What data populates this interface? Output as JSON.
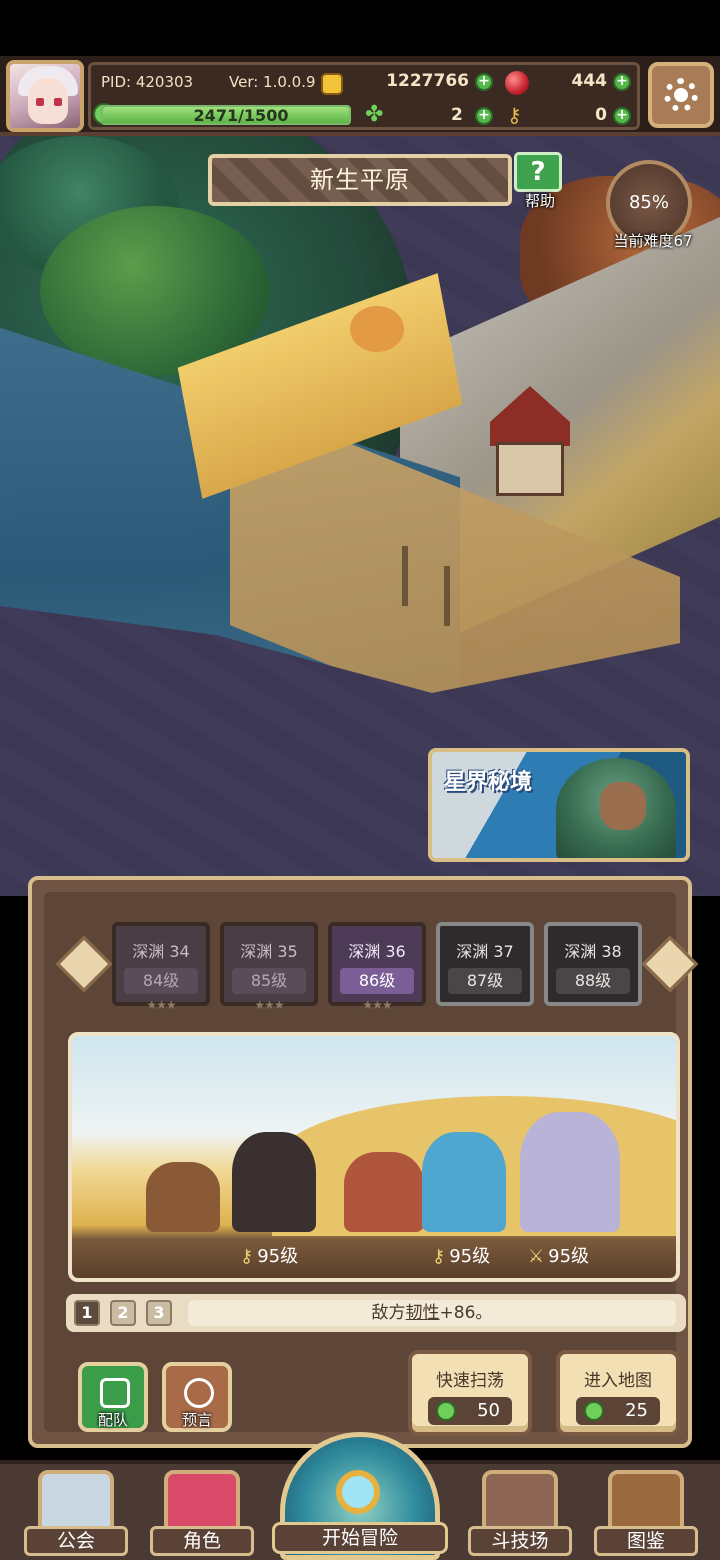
{
  "header": {
    "pid": "PID: 420303",
    "version": "Ver: 1.0.0.9",
    "gold": "1227766",
    "gems": "444",
    "xp_text": "2471/1500",
    "xp_fill_fraction": 1.0,
    "clovers": "2",
    "keys": "0"
  },
  "map": {
    "area_name": "新生平原",
    "help_label": "帮助",
    "difficulty_percent": "85%",
    "difficulty_label": "当前难度67",
    "astral_title": "星界秘境"
  },
  "stages": [
    {
      "name": "深渊 34",
      "level": "84级",
      "stars": "★★★",
      "state": "cleared"
    },
    {
      "name": "深渊 35",
      "level": "85级",
      "stars": "★★★",
      "state": "cleared"
    },
    {
      "name": "深渊 36",
      "level": "86级",
      "stars": "★★★",
      "state": "current"
    },
    {
      "name": "深渊 37",
      "level": "87级",
      "stars": "",
      "state": "locked"
    },
    {
      "name": "深渊 38",
      "level": "88级",
      "stars": "",
      "state": "locked"
    }
  ],
  "enemies": {
    "levels": [
      "95级",
      "95级",
      "95级"
    ]
  },
  "pager": {
    "pages": [
      "1",
      "2",
      "3"
    ],
    "active": 1,
    "effect_prefix": "敌方",
    "effect_keyword": "韧性",
    "effect_suffix": "+86。"
  },
  "actions": {
    "team_label": "配队",
    "omen_label": "预言",
    "sweep_label": "快速扫荡",
    "sweep_cost": "50",
    "enter_label": "进入地图",
    "enter_cost": "25"
  },
  "nav": {
    "guild": "公会",
    "character": "角色",
    "adventure": "开始冒险",
    "arena": "斗技场",
    "codex": "图鉴"
  },
  "colors": {
    "accent_green": "#55b64a",
    "frame_gold": "#d9be8d",
    "current_stage": "#7b5e96"
  }
}
